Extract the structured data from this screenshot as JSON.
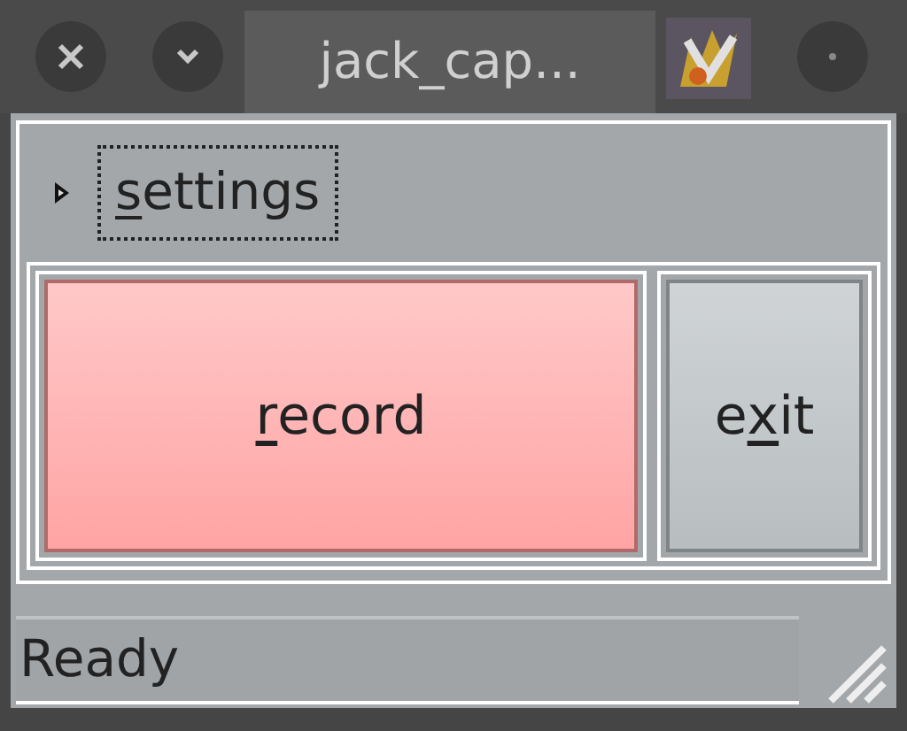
{
  "window": {
    "title": "jack_cap..."
  },
  "expander": {
    "key": "s",
    "post": "ettings",
    "expanded": false,
    "focused": true
  },
  "buttons": [
    {
      "kind": "record",
      "key": "r",
      "post": "ecord"
    },
    {
      "kind": "exit",
      "pre": "e",
      "key": "x",
      "post": "it"
    }
  ],
  "status_bar": {
    "text": "Ready"
  }
}
